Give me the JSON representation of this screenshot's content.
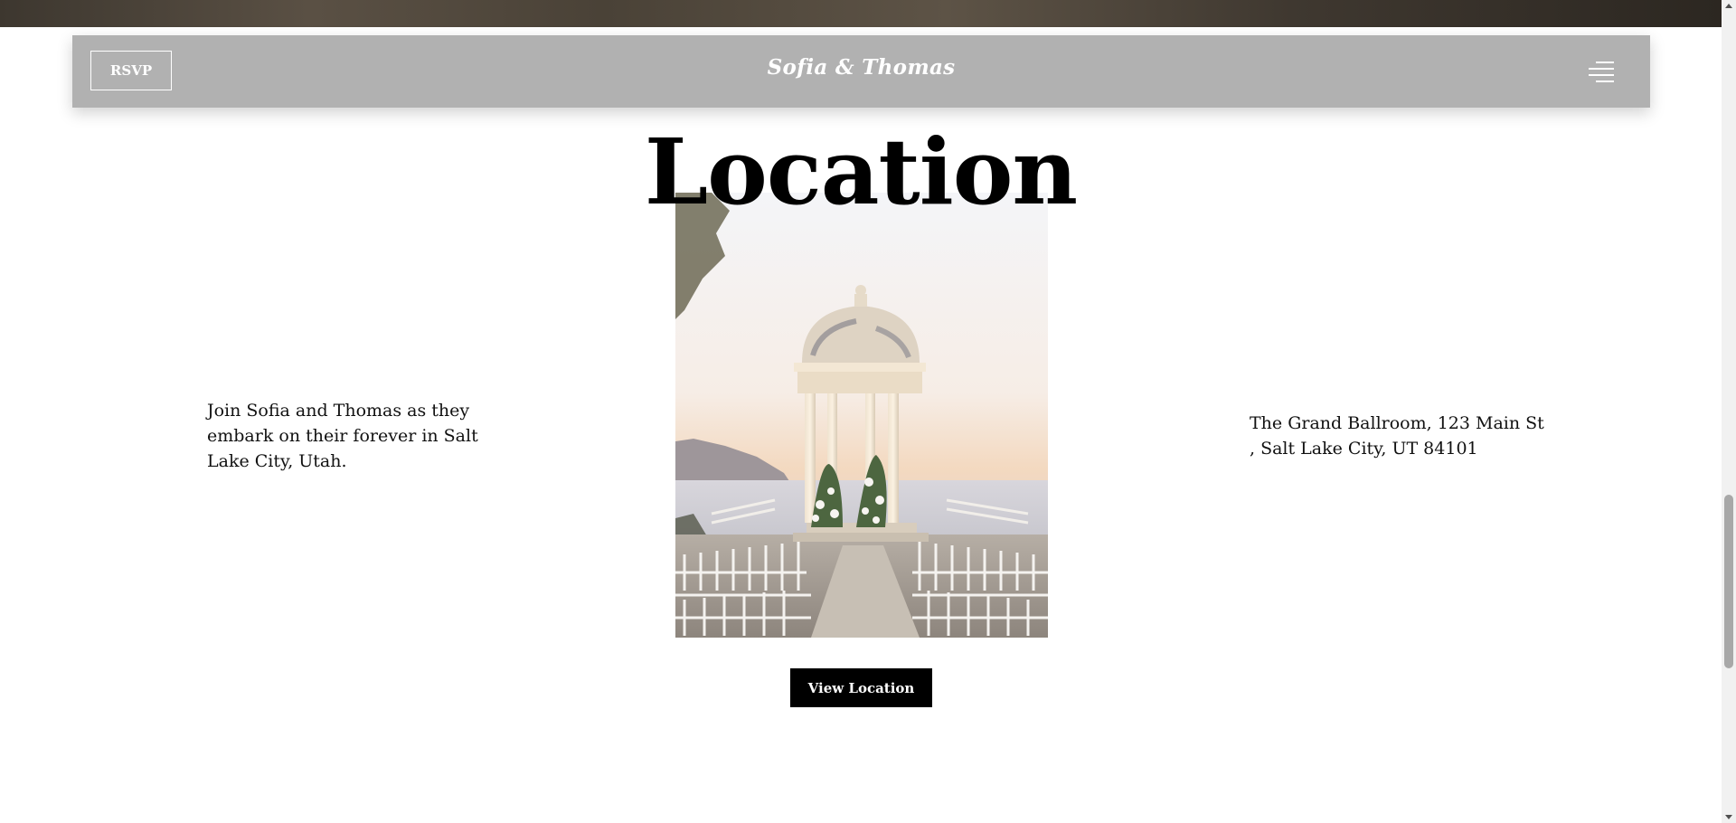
{
  "header": {
    "rsvp_label": "RSVP",
    "brand_name": "Sofia & Thomas",
    "menu_icon": "hamburger-menu-icon"
  },
  "location": {
    "title": "Location",
    "intro": "Join Sofia and Thomas as they embark on their forever in Salt Lake City, Utah.",
    "address_line1": "The Grand Ballroom, 123 Main St",
    "address_line2": ", Salt Lake City, UT 84101",
    "view_button_label": "View Location",
    "photo": "venue-gazebo-photo"
  },
  "colors": {
    "navbar_bg": "#b1b1b1",
    "button_bg": "#000000",
    "text": "#111111"
  }
}
